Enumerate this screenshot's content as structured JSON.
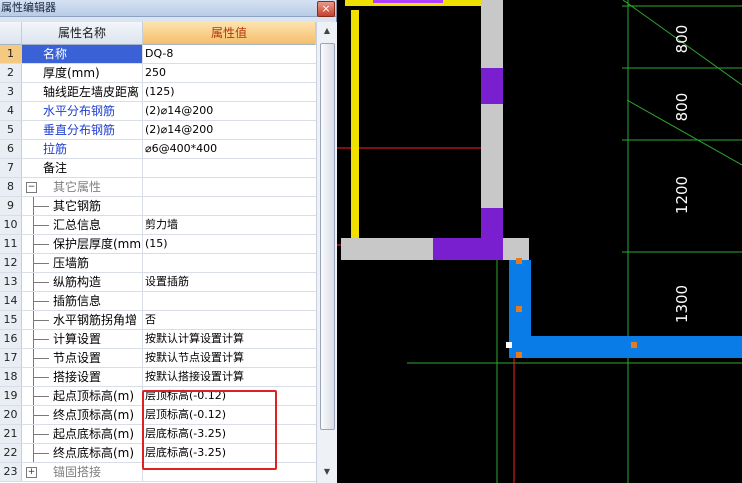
{
  "window": {
    "title": "属性编辑器",
    "close": "×"
  },
  "grid": {
    "headers": {
      "name": "属性名称",
      "value": "属性值"
    },
    "rows": [
      {
        "no": "1",
        "name": "名称",
        "value": "DQ-8",
        "style": "blue",
        "selected": true
      },
      {
        "no": "2",
        "name": "厚度(mm)",
        "value": "250",
        "style": "normal"
      },
      {
        "no": "3",
        "name": "轴线距左墙皮距离",
        "value": "(125)",
        "style": "normal"
      },
      {
        "no": "4",
        "name": "水平分布钢筋",
        "value": "(2)⌀14@200",
        "style": "blue"
      },
      {
        "no": "5",
        "name": "垂直分布钢筋",
        "value": "(2)⌀14@200",
        "style": "blue"
      },
      {
        "no": "6",
        "name": "拉筋",
        "value": "⌀6@400*400",
        "style": "blue"
      },
      {
        "no": "7",
        "name": "备注",
        "value": "",
        "style": "normal"
      },
      {
        "no": "8",
        "name": "其它属性",
        "value": "",
        "style": "group-open"
      },
      {
        "no": "9",
        "name": "其它钢筋",
        "value": "",
        "style": "sub"
      },
      {
        "no": "10",
        "name": "汇总信息",
        "value": "剪力墙",
        "style": "sub"
      },
      {
        "no": "11",
        "name": "保护层厚度(mm)",
        "value": "(15)",
        "style": "sub"
      },
      {
        "no": "12",
        "name": "压墙筋",
        "value": "",
        "style": "sub"
      },
      {
        "no": "13",
        "name": "纵筋构造",
        "value": "设置插筋",
        "style": "sub"
      },
      {
        "no": "14",
        "name": "插筋信息",
        "value": "",
        "style": "sub"
      },
      {
        "no": "15",
        "name": "水平钢筋拐角增",
        "value": "否",
        "style": "sub"
      },
      {
        "no": "16",
        "name": "计算设置",
        "value": "按默认计算设置计算",
        "style": "sub"
      },
      {
        "no": "17",
        "name": "节点设置",
        "value": "按默认节点设置计算",
        "style": "sub"
      },
      {
        "no": "18",
        "name": "搭接设置",
        "value": "按默认搭接设置计算",
        "style": "sub"
      },
      {
        "no": "19",
        "name": "起点顶标高(m)",
        "value": "层顶标高(-0.12)",
        "style": "sub"
      },
      {
        "no": "20",
        "name": "终点顶标高(m)",
        "value": "层顶标高(-0.12)",
        "style": "sub"
      },
      {
        "no": "21",
        "name": "起点底标高(m)",
        "value": "层底标高(-3.25)",
        "style": "sub"
      },
      {
        "no": "22",
        "name": "终点底标高(m)",
        "value": "层底标高(-3.25)",
        "style": "sub"
      },
      {
        "no": "23",
        "name": "锚固搭接",
        "value": "",
        "style": "group-closed"
      }
    ]
  },
  "drawing": {
    "dimensions": [
      "800",
      "800",
      "1200",
      "1300"
    ],
    "colors": {
      "background": "#000000",
      "wall_blue": "#0a7ce8",
      "wall_purple": "#7a1fd0",
      "wall_gray": "#c8c8c8",
      "axis_red": "#ff2020",
      "grid_green": "#2ea82e",
      "yellow": "#f0e000",
      "marker_orange": "#e87a1e"
    }
  }
}
